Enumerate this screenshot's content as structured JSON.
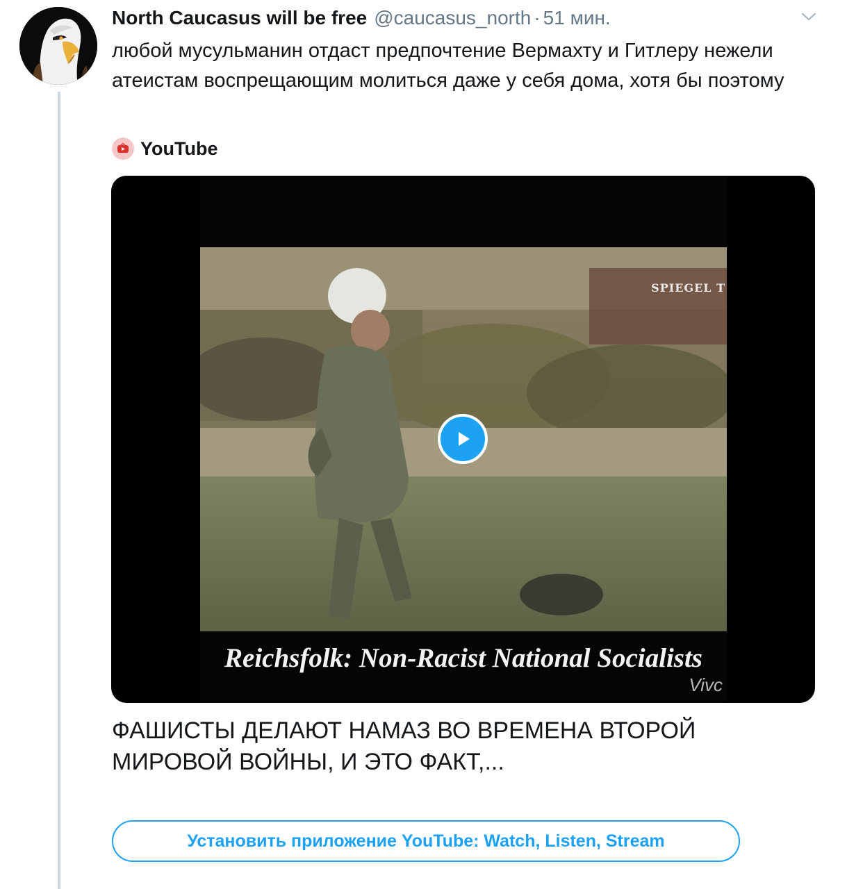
{
  "tweet": {
    "display_name": "North Caucasus will be free",
    "handle": "@caucasus_north",
    "separator": "·",
    "time": "51 мин.",
    "avatar_icon": "bald-eagle-avatar",
    "more_icon": "chevron-down-icon",
    "text": "любой мусульманин отдаст предпочтение Вермахту и Гитлеру нежели атеистам воспрещающим молиться даже у себя дома, хотя бы поэтому"
  },
  "card": {
    "source_icon": "youtube-icon",
    "source_name": "YouTube",
    "video_watermark": "SPIEGEL T",
    "video_caption": "Reichsfolk: Non-Racist National Socialists",
    "video_subcaption": "Vivc",
    "play_icon": "play-icon",
    "title": "ФАШИСТЫ ДЕЛАЮТ НАМАЗ ВО ВРЕМЕНА ВТОРОЙ МИРОВОЙ ВОЙНЫ, И ЭТО ФАКТ,...",
    "install_label": "Установить приложение YouTube: Watch, Listen, Stream"
  },
  "colors": {
    "accent": "#1da1f2",
    "text": "#14171a",
    "secondary_text": "#657786",
    "thread_line": "#ccd6dd",
    "youtube_red": "#e0302b"
  }
}
